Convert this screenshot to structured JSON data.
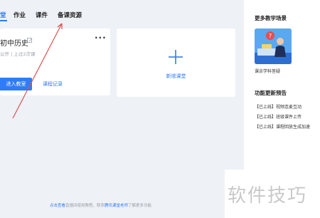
{
  "nav": {
    "items": [
      {
        "label": "堂",
        "active": true
      },
      {
        "label": "作业",
        "active": false
      },
      {
        "label": "课件",
        "active": false
      },
      {
        "label": "备课资源",
        "active": false
      }
    ]
  },
  "course": {
    "title": "初中历史",
    "meta": "公开 | 上过2次课",
    "enter_label": "进入教室",
    "record_label": "课程记录",
    "more_label": "···"
  },
  "new_course": {
    "label": "新增课堂"
  },
  "bottom_hint": {
    "link1": "点击查看",
    "text1": "直播间使用教程，联系",
    "link2": "腾讯课堂老师",
    "text2": "了解更多功能"
  },
  "right_panel": {
    "scenes_title": "更多教学场景",
    "scene_label": "课余学科答疑",
    "updates_title": "功能更新预告",
    "updates": [
      "【已上线】视频连麦互动",
      "【已上线】班级课件上传",
      "【已上线】课程回放生成加速"
    ]
  },
  "watermark": {
    "text": "软件技巧"
  },
  "colors": {
    "accent": "#2f7cf6",
    "annotation_arrow": "#d9534f"
  }
}
